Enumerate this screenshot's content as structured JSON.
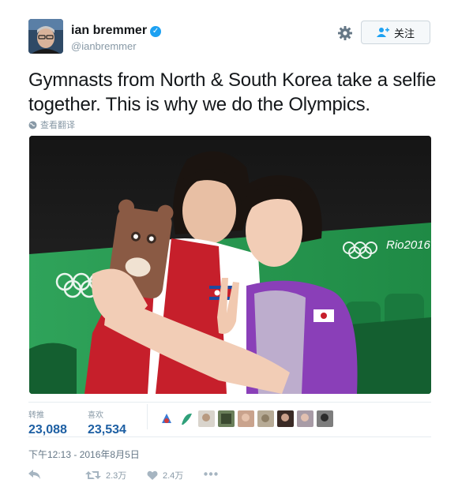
{
  "author": {
    "name": "ian bremmer",
    "handle": "@ianbremmer",
    "verified_mark": "✓"
  },
  "header": {
    "follow_label": "关注"
  },
  "tweet": {
    "text": "Gymnasts from North & South Korea take a selfie together. This is why we do the Olympics.",
    "translate_label": "查看翻译"
  },
  "stats": {
    "retweets_label": "转推",
    "retweets_value": "23,088",
    "likes_label": "喜欢",
    "likes_value": "23,534"
  },
  "timestamp": "下午12:13 - 2016年8月5日",
  "actions": {
    "retweet_count": "2.3万",
    "like_count": "2.4万"
  },
  "photo": {
    "ring_caption": "Rio2016"
  },
  "icons": [
    "gear-icon",
    "add-user-icon",
    "globe-icon",
    "reply-icon",
    "retweet-icon",
    "heart-icon",
    "more-icon",
    "verified-icon"
  ],
  "colors": {
    "accent": "#1da1f2",
    "count_blue": "#1d5fa3",
    "muted": "#8899a6"
  }
}
